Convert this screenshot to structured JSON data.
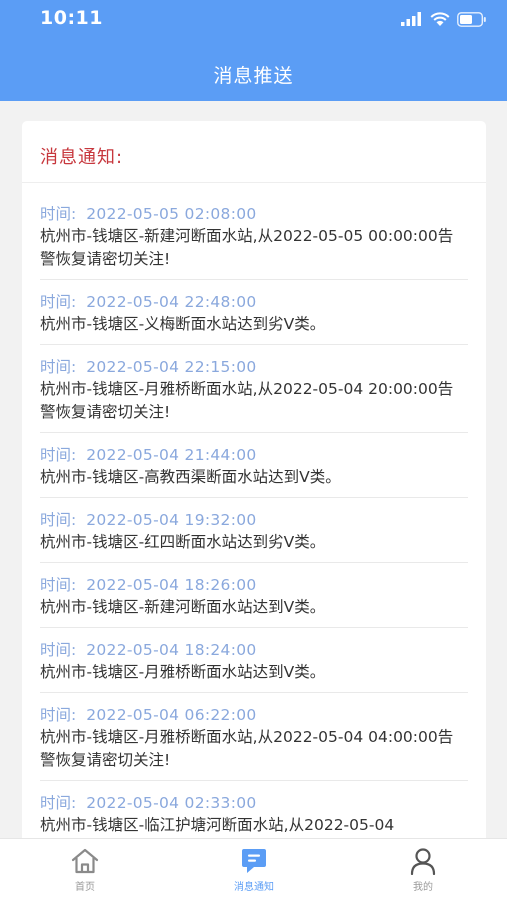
{
  "status_bar": {
    "time": "10:11"
  },
  "header": {
    "title": "消息推送"
  },
  "card": {
    "title": "消息通知:"
  },
  "time_prefix": "时间:",
  "messages": [
    {
      "time": "2022-05-05 02:08:00",
      "text": "杭州市-钱塘区-新建河断面水站,从2022-05-05 00:00:00告警恢复请密切关注!"
    },
    {
      "time": "2022-05-04 22:48:00",
      "text": "杭州市-钱塘区-义梅断面水站达到劣V类。"
    },
    {
      "time": "2022-05-04 22:15:00",
      "text": "杭州市-钱塘区-月雅桥断面水站,从2022-05-04 20:00:00告警恢复请密切关注!"
    },
    {
      "time": "2022-05-04 21:44:00",
      "text": "杭州市-钱塘区-高教西渠断面水站达到V类。"
    },
    {
      "time": "2022-05-04 19:32:00",
      "text": "杭州市-钱塘区-红四断面水站达到劣V类。"
    },
    {
      "time": "2022-05-04 18:26:00",
      "text": "杭州市-钱塘区-新建河断面水站达到V类。"
    },
    {
      "time": "2022-05-04 18:24:00",
      "text": "杭州市-钱塘区-月雅桥断面水站达到V类。"
    },
    {
      "time": "2022-05-04 06:22:00",
      "text": "杭州市-钱塘区-月雅桥断面水站,从2022-05-04 04:00:00告警恢复请密切关注!"
    },
    {
      "time": "2022-05-04 02:33:00",
      "text": "杭州市-钱塘区-临江护塘河断面水站,从2022-05-04"
    }
  ],
  "tabbar": {
    "home_label": "首页",
    "messages_label": "消息通知",
    "mine_label": "我的",
    "active_color": "#5b9df5",
    "inactive_color": "#9a9a9a"
  },
  "icons": {
    "signal": "signal-icon",
    "wifi": "wifi-icon",
    "battery": "battery-icon",
    "home": "home-icon",
    "message": "message-icon",
    "user": "user-icon"
  },
  "colors": {
    "header": "#5b9df5",
    "card_title": "#c7373d",
    "time_text": "#8aa8dd"
  }
}
